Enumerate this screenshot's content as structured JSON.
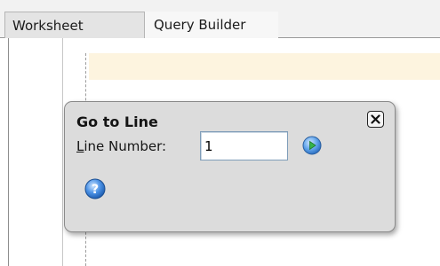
{
  "tabs": [
    {
      "label": "Worksheet"
    },
    {
      "label": "Query Builder"
    }
  ],
  "dialog": {
    "title": "Go to Line",
    "line_label_prefix": "L",
    "line_label_rest": "ine Number:",
    "line_value": "1",
    "close_icon": "close-icon",
    "go_icon": "play-icon",
    "help_icon": "help-icon"
  },
  "colors": {
    "dialog_bg": "#dcdcdc",
    "highlight_line": "#fdf4df",
    "button_blue": "#2f7fd8"
  }
}
